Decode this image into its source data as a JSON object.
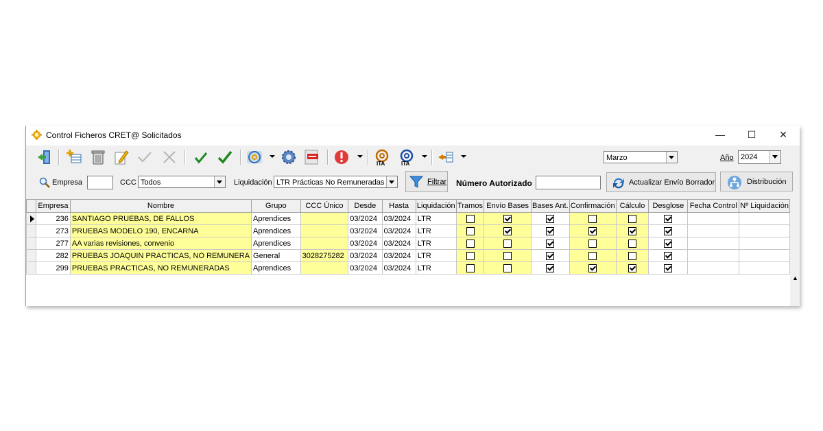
{
  "window": {
    "title": "Control Ficheros CRET@ Solicitados"
  },
  "toolbar": {
    "month": "Marzo",
    "year_label": "Año",
    "year": "2024"
  },
  "filters": {
    "empresa_label": "Empresa",
    "empresa_value": "",
    "ccc_label": "CCC",
    "ccc_value": "Todos",
    "liquidacion_label": "Liquidación",
    "liquidacion_value": "LTR Prácticas No Remuneradas",
    "filtrar_label": "Filtrar",
    "numero_autorizado_label": "Número Autorizado",
    "numero_autorizado_value": "",
    "actualizar_label": "Actualizar Envío Borrador",
    "distribucion_label": "Distribución"
  },
  "grid": {
    "columns": [
      "Empresa",
      "Nombre",
      "Grupo",
      "CCC Único",
      "Desde",
      "Hasta",
      "Liquidación",
      "Tramos",
      "Envío Bases",
      "Bases Ant.",
      "Confirmación",
      "Cálculo",
      "Desglose",
      "Fecha Control",
      "Nº Liquidación"
    ],
    "rows": [
      {
        "empresa": "236",
        "nombre": "SANTIAGO PRUEBAS, DE FALLOS",
        "grupo": "Aprendices",
        "ccc": "",
        "desde": "03/2024",
        "hasta": "03/2024",
        "liquidacion": "LTR",
        "tramos": false,
        "envio_bases": true,
        "bases_ant": true,
        "confirmacion": false,
        "calculo": false,
        "desglose": true,
        "fecha_control": "",
        "n_liquidacion": ""
      },
      {
        "empresa": "273",
        "nombre": "PRUEBAS MODELO 190, ENCARNA",
        "grupo": "Aprendices",
        "ccc": "",
        "desde": "03/2024",
        "hasta": "03/2024",
        "liquidacion": "LTR",
        "tramos": false,
        "envio_bases": true,
        "bases_ant": true,
        "confirmacion": true,
        "calculo": true,
        "desglose": true,
        "fecha_control": "",
        "n_liquidacion": ""
      },
      {
        "empresa": "277",
        "nombre": "AA varias revisiones, convenio",
        "grupo": "Aprendices",
        "ccc": "",
        "desde": "03/2024",
        "hasta": "03/2024",
        "liquidacion": "LTR",
        "tramos": false,
        "envio_bases": false,
        "bases_ant": true,
        "confirmacion": false,
        "calculo": false,
        "desglose": true,
        "fecha_control": "",
        "n_liquidacion": ""
      },
      {
        "empresa": "282",
        "nombre": "PRUEBAS JOAQUIN PRACTICAS, NO REMUNERA",
        "grupo": "General",
        "ccc": "3028275282",
        "desde": "03/2024",
        "hasta": "03/2024",
        "liquidacion": "LTR",
        "tramos": false,
        "envio_bases": false,
        "bases_ant": true,
        "confirmacion": false,
        "calculo": false,
        "desglose": true,
        "fecha_control": "",
        "n_liquidacion": ""
      },
      {
        "empresa": "299",
        "nombre": "PRUEBAS PRACTICAS, NO REMUNERADAS",
        "grupo": "Aprendices",
        "ccc": "",
        "desde": "03/2024",
        "hasta": "03/2024",
        "liquidacion": "LTR",
        "tramos": false,
        "envio_bases": false,
        "bases_ant": true,
        "confirmacion": true,
        "calculo": true,
        "desglose": true,
        "fecha_control": "",
        "n_liquidacion": ""
      }
    ]
  }
}
